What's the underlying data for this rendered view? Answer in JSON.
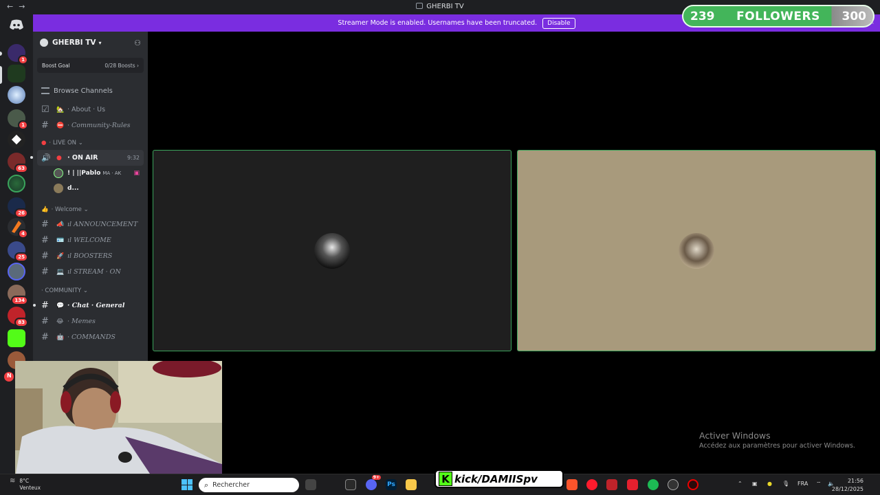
{
  "titlebar": {
    "title": "GHERBI TV",
    "back": "←",
    "forward": "→"
  },
  "banner": {
    "text": "Streamer Mode is enabled. Usernames have been truncated.",
    "button": "Disable"
  },
  "overlay": {
    "followers_current": "239",
    "followers_label": "FOLLOWERS",
    "followers_goal": "300",
    "close": "×",
    "progress_fraction": 0.797
  },
  "rail": {
    "badges": [
      "1",
      "1",
      "63",
      "26",
      "4",
      "25",
      "134",
      "83",
      "N"
    ]
  },
  "sidebar": {
    "guild_name": "GHERBI TV",
    "boost_label": "Boost Goal",
    "boost_value": "0/28 Boosts ›",
    "browse": "Browse Channels",
    "ch_about_emoji": "🏡",
    "ch_about": "· About · Us",
    "ch_rules": "· Community-Rules",
    "cat_live": "· LIVE ON ⌄",
    "ch_onair": "· ON AIR",
    "ch_onair_time": "9:32",
    "voice_user_1": "! | ||Pablo",
    "voice_user_1_tag": "MA · AK",
    "voice_user_2": "d...",
    "cat_welcome": "· Welcome ⌄",
    "ch_announcement": "ıl ANNOUNCEMENT",
    "ch_welcome": "ıl WELCOME",
    "ch_boosters": "ıl BOOSTERS",
    "ch_stream": "ıl STREAM · ON",
    "cat_community": "· COMMUNITY ⌄",
    "ch_chat": "· Chat · General",
    "ch_memes": "· Memes",
    "ch_commands": "· COMMANDS"
  },
  "watermark": {
    "line1": "Activer Windows",
    "line2": "Accédez aux paramètres pour activer Windows."
  },
  "taskbar": {
    "weather_temp": "8°C",
    "weather_desc": "Venteux",
    "search_placeholder": "Rechercher",
    "kick_text": "kick/DAMIISpv",
    "kick_logo": "K",
    "lang": "FRA",
    "time": "21:56",
    "date": "28/12/2025",
    "discord_badge": "9+"
  },
  "colors": {
    "accent": "#7a2de0",
    "speaking": "#3ba55c",
    "kick": "#53fc18",
    "badge": "#f23f42"
  }
}
